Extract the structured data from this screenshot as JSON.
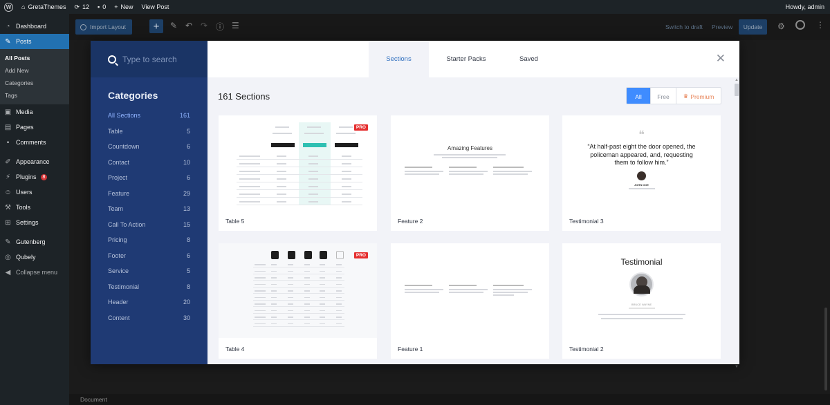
{
  "adminbar": {
    "site_name": "GretaThemes",
    "updates_count": "12",
    "comments_count": "0",
    "new_label": "New",
    "view_post_label": "View Post",
    "howdy_label": "Howdy, admin"
  },
  "adminmenu": {
    "items": [
      {
        "label": "Dashboard"
      },
      {
        "label": "Posts"
      },
      {
        "label": "Media"
      },
      {
        "label": "Pages"
      },
      {
        "label": "Comments"
      },
      {
        "label": "Appearance"
      },
      {
        "label": "Plugins",
        "badge": "8"
      },
      {
        "label": "Users"
      },
      {
        "label": "Tools"
      },
      {
        "label": "Settings"
      },
      {
        "label": "Gutenberg"
      },
      {
        "label": "Qubely"
      },
      {
        "label": "Collapse menu"
      }
    ],
    "posts_submenu": [
      "All Posts",
      "Add New",
      "Categories",
      "Tags"
    ]
  },
  "editor": {
    "import_layout_label": "Import Layout",
    "switch_to_draft_label": "Switch to draft",
    "preview_label": "Preview",
    "update_label": "Update",
    "footer_label": "Document"
  },
  "modal": {
    "search_placeholder": "Type to search",
    "categories_title": "Categories",
    "categories": [
      {
        "name": "All Sections",
        "count": "161"
      },
      {
        "name": "Table",
        "count": "5"
      },
      {
        "name": "Countdown",
        "count": "6"
      },
      {
        "name": "Contact",
        "count": "10"
      },
      {
        "name": "Project",
        "count": "6"
      },
      {
        "name": "Feature",
        "count": "29"
      },
      {
        "name": "Team",
        "count": "13"
      },
      {
        "name": "Call To Action",
        "count": "15"
      },
      {
        "name": "Pricing",
        "count": "8"
      },
      {
        "name": "Footer",
        "count": "6"
      },
      {
        "name": "Service",
        "count": "5"
      },
      {
        "name": "Testimonial",
        "count": "8"
      },
      {
        "name": "Header",
        "count": "20"
      },
      {
        "name": "Content",
        "count": "30"
      }
    ],
    "tabs": [
      "Sections",
      "Starter Packs",
      "Saved"
    ],
    "section_count_label": "161 Sections",
    "filters": {
      "all": "All",
      "free": "Free",
      "premium": "Premium"
    },
    "pro_badge": "PRO",
    "cards": [
      {
        "label": "Table 5"
      },
      {
        "label": "Feature 2",
        "preview_title": "Amazing Features"
      },
      {
        "label": "Testimonial 3",
        "preview_quote": "“At half-past eight the door opened, the policeman appeared, and, requesting them to follow him.”",
        "preview_name": "JOHN DOE"
      },
      {
        "label": "Table 4"
      },
      {
        "label": "Feature 1"
      },
      {
        "label": "Testimonial 2",
        "preview_title": "Testimonial",
        "preview_name": "BRUCE WAYNE"
      }
    ]
  },
  "colors": {
    "wp_blue": "#2271b1",
    "modal_sidebar": "#1f3a74",
    "filter_active": "#3f8cff",
    "pro_red": "#e52e2e",
    "premium_orange": "#e8855a"
  }
}
